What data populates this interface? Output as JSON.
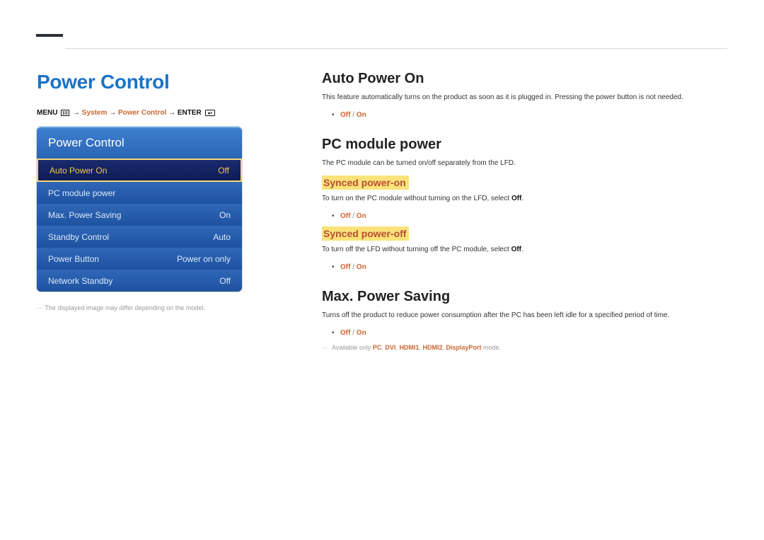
{
  "page": {
    "title": "Power Control"
  },
  "breadcrumb": {
    "menu_label": "MENU",
    "arrow": "→",
    "system_label": "System",
    "power_control_label": "Power Control",
    "enter_label": "ENTER"
  },
  "panel": {
    "header": "Power Control",
    "rows": [
      {
        "label": "Auto Power On",
        "value": "Off",
        "selected": true
      },
      {
        "label": "PC module power",
        "value": "",
        "selected": false
      },
      {
        "label": "Max. Power Saving",
        "value": "On",
        "selected": false
      },
      {
        "label": "Standby Control",
        "value": "Auto",
        "selected": false
      },
      {
        "label": "Power Button",
        "value": "Power on only",
        "selected": false
      },
      {
        "label": "Network Standby",
        "value": "Off",
        "selected": false
      }
    ],
    "note": "The displayed image may differ depending on the model."
  },
  "sections": {
    "auto_power_on": {
      "title": "Auto Power On",
      "desc": "This feature automatically turns on the product as soon as it is plugged in. Pressing the power button is not needed.",
      "off": "Off",
      "sep": "/",
      "on": "On"
    },
    "pc_module_power": {
      "title": "PC module power",
      "desc": "The PC module can be turned on/off separately from the LFD.",
      "synced_power_on": {
        "title": "Synced power-on",
        "desc_prefix": "To turn on the PC module without turning on the LFD, select ",
        "desc_bold": "Off",
        "desc_suffix": ".",
        "off": "Off",
        "sep": "/",
        "on": "On"
      },
      "synced_power_off": {
        "title": "Synced power-off",
        "desc_prefix": "To turn off the LFD without turning off the PC module, select ",
        "desc_bold": "Off",
        "desc_suffix": ".",
        "off": "Off",
        "sep": "/",
        "on": "On"
      }
    },
    "max_power_saving": {
      "title": "Max. Power Saving",
      "desc": "Turns off the product to reduce power consumption after the PC has been left idle for a specified period of time.",
      "off": "Off",
      "sep": "/",
      "on": "On",
      "note_prefix": "Available only ",
      "modes": {
        "pc": "PC",
        "dvi": "DVI",
        "hdmi1": "HDMI1",
        "hdmi2": "HDMI2",
        "dp": "DisplayPort"
      },
      "comma": ", ",
      "note_suffix": " mode."
    }
  }
}
